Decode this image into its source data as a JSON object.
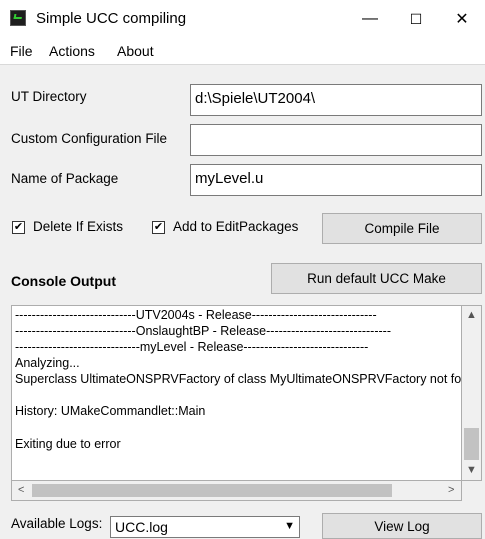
{
  "window": {
    "title": "Simple UCC compiling",
    "minimize_glyph": "—",
    "maximize_glyph": "☐",
    "close_glyph": "✕"
  },
  "menu": {
    "file": "File",
    "actions": "Actions",
    "about": "About"
  },
  "form": {
    "ut_directory_label": "UT Directory",
    "ut_directory_value": "d:\\Spiele\\UT2004\\",
    "custom_config_label": "Custom Configuration File",
    "custom_config_value": "",
    "package_label": "Name of Package",
    "package_value": "myLevel.u"
  },
  "options": {
    "delete_if_exists_label": "Delete If Exists",
    "delete_if_exists_checked": true,
    "add_to_editpackages_label": "Add to EditPackages",
    "add_to_editpackages_checked": true,
    "check_glyph": "✔"
  },
  "buttons": {
    "compile": "Compile File",
    "run_default": "Run default UCC Make",
    "view_log": "View Log"
  },
  "console": {
    "heading": "Console Output",
    "lines": [
      "-----------------------------UTV2004s - Release------------------------------",
      "-----------------------------OnslaughtBP - Release------------------------------",
      "------------------------------myLevel - Release------------------------------",
      "Analyzing...",
      "Superclass UltimateONSPRVFactory of class MyUltimateONSPRVFactory not found",
      "",
      "History: UMakeCommandlet::Main",
      "",
      "Exiting due to error"
    ],
    "scroll_up": "▲",
    "scroll_down": "▼",
    "scroll_left": "<",
    "scroll_right": ">"
  },
  "logs": {
    "label": "Available Logs:",
    "selected": "UCC.log",
    "dropdown_glyph": "▼"
  }
}
